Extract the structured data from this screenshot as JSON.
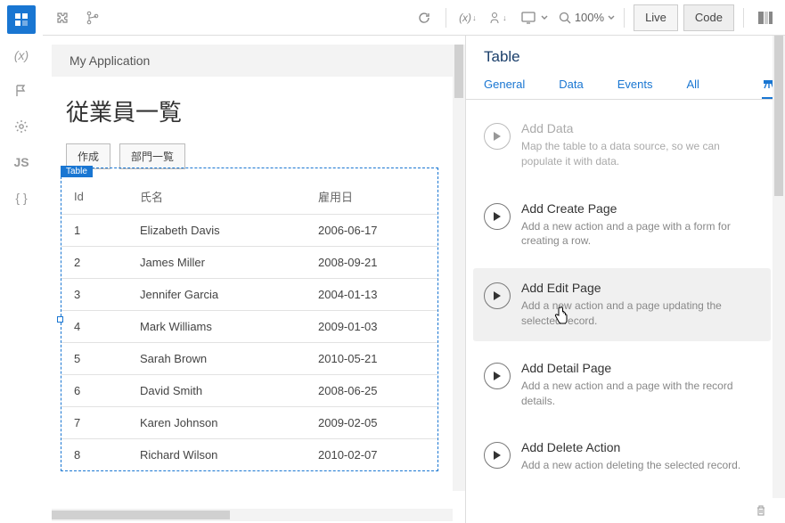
{
  "toolbar": {
    "zoom_label": "100%",
    "live_label": "Live",
    "code_label": "Code"
  },
  "app": {
    "title": "My Application"
  },
  "page": {
    "title": "従業員一覧"
  },
  "page_buttons": {
    "create": "作成",
    "dept_list": "部門一覧"
  },
  "selection_tag": "Table",
  "table": {
    "headers": {
      "id": "Id",
      "name": "氏名",
      "hired": "雇用日"
    },
    "rows": [
      {
        "id": "1",
        "name": "Elizabeth Davis",
        "hired": "2006-06-17"
      },
      {
        "id": "2",
        "name": "James Miller",
        "hired": "2008-09-21"
      },
      {
        "id": "3",
        "name": "Jennifer Garcia",
        "hired": "2004-01-13"
      },
      {
        "id": "4",
        "name": "Mark Williams",
        "hired": "2009-01-03"
      },
      {
        "id": "5",
        "name": "Sarah Brown",
        "hired": "2010-05-21"
      },
      {
        "id": "6",
        "name": "David Smith",
        "hired": "2008-06-25"
      },
      {
        "id": "7",
        "name": "Karen Johnson",
        "hired": "2009-02-05"
      },
      {
        "id": "8",
        "name": "Richard Wilson",
        "hired": "2010-02-07"
      }
    ]
  },
  "inspector": {
    "title": "Table",
    "tabs": {
      "general": "General",
      "data": "Data",
      "events": "Events",
      "all": "All"
    },
    "actions": {
      "add_data": {
        "title": "Add Data",
        "desc": "Map the table to a data source, so we can populate it with data."
      },
      "add_create": {
        "title": "Add Create Page",
        "desc": "Add a new action and a page with a form for creating a row."
      },
      "add_edit": {
        "title": "Add Edit Page",
        "desc": "Add a new action and a page updating the selected record."
      },
      "add_detail": {
        "title": "Add Detail Page",
        "desc": "Add a new action and a page with the record details."
      },
      "add_delete": {
        "title": "Add Delete Action",
        "desc": "Add a new action deleting the selected record."
      }
    }
  }
}
